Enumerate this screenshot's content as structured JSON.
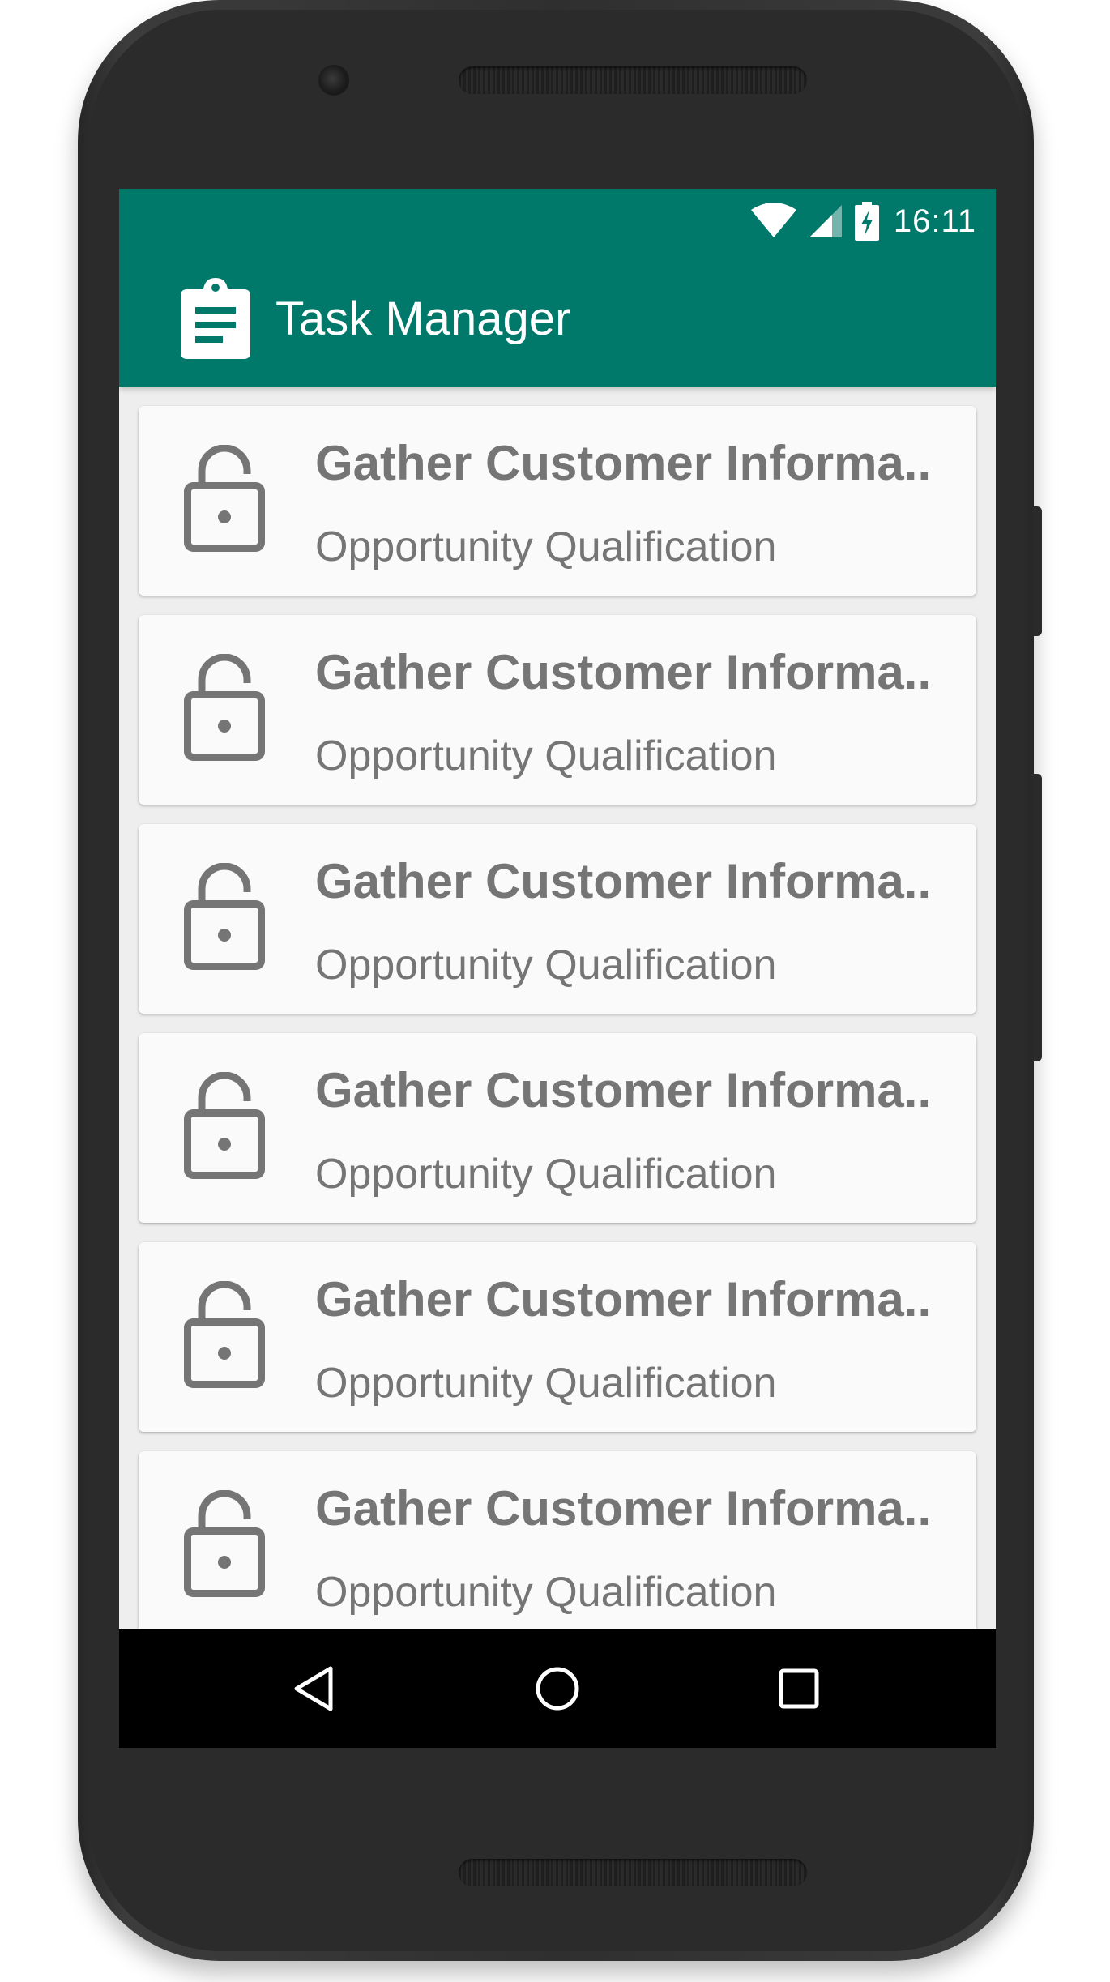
{
  "status_bar": {
    "time": "16:11",
    "icons": [
      "wifi-icon",
      "cell-signal-icon",
      "battery-charging-icon"
    ]
  },
  "app_bar": {
    "icon": "clipboard-icon",
    "title": "Task Manager",
    "background_color": "#00796b"
  },
  "tasks": [
    {
      "title": "Gather Customer Informa..",
      "subtitle": "Opportunity Qualification",
      "icon": "lock-open-icon"
    },
    {
      "title": "Gather Customer Informa..",
      "subtitle": "Opportunity Qualification",
      "icon": "lock-open-icon"
    },
    {
      "title": "Gather Customer Informa..",
      "subtitle": "Opportunity Qualification",
      "icon": "lock-open-icon"
    },
    {
      "title": "Gather Customer Informa..",
      "subtitle": "Opportunity Qualification",
      "icon": "lock-open-icon"
    },
    {
      "title": "Gather Customer Informa..",
      "subtitle": "Opportunity Qualification",
      "icon": "lock-open-icon"
    },
    {
      "title": "Gather Customer Informa..",
      "subtitle": "Opportunity Qualification",
      "icon": "lock-open-icon"
    }
  ],
  "nav_bar": {
    "buttons": [
      "back-icon",
      "home-icon",
      "recents-icon"
    ]
  }
}
